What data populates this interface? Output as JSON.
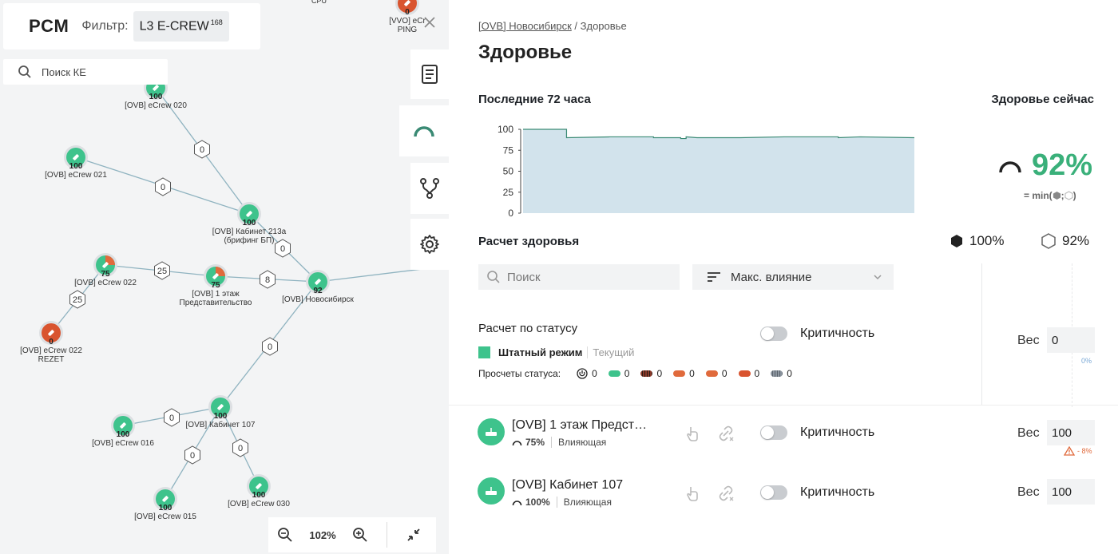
{
  "app": {
    "logo": "PCM",
    "filter_label": "Фильтр:",
    "filter_value": "L3 E-CREW",
    "filter_count": "168",
    "search_placeholder": "Поиск КЕ",
    "zoom": "102%"
  },
  "graph": {
    "nodes": [
      {
        "id": "n020",
        "score": "100",
        "label": [
          "[OVB] eCrew 020"
        ],
        "status": "green"
      },
      {
        "id": "n021",
        "score": "100",
        "label": [
          "[OVB] eCrew 021"
        ],
        "status": "green"
      },
      {
        "id": "n213",
        "score": "100",
        "label": [
          "[OVB] Кабинет 213a",
          "(брифинг БП)"
        ],
        "status": "green"
      },
      {
        "id": "n022",
        "score": "75",
        "label": [
          "[OVB] eCrew 022"
        ],
        "status": "partial"
      },
      {
        "id": "n1et",
        "score": "75",
        "label": [
          "[OVB] 1 этаж",
          "Представительство"
        ],
        "status": "partial"
      },
      {
        "id": "nnsk",
        "score": "92",
        "label": [
          "[OVB] Новосибирск"
        ],
        "status": "green"
      },
      {
        "id": "nrez",
        "score": "0",
        "label": [
          "[OVB] eCrew 022",
          "REZET"
        ],
        "status": "red"
      },
      {
        "id": "n107",
        "score": "100",
        "label": [
          "[OVB] Кабинет 107"
        ],
        "status": "green"
      },
      {
        "id": "n016",
        "score": "100",
        "label": [
          "[OVB] eCrew 016"
        ],
        "status": "green"
      },
      {
        "id": "n015",
        "score": "100",
        "label": [
          "[OVB] eCrew 015"
        ],
        "status": "green"
      },
      {
        "id": "n030",
        "score": "100",
        "label": [
          "[OVB] eCrew 030"
        ],
        "status": "green"
      },
      {
        "id": "nvvo",
        "score": "0",
        "label": [
          "[VVO] eCr",
          "PING"
        ],
        "status": "red"
      }
    ],
    "edges": [
      {
        "from": "n020",
        "to": "n213",
        "weight": "0"
      },
      {
        "from": "n021",
        "to": "n213",
        "weight": "0"
      },
      {
        "from": "n213",
        "to": "nnsk",
        "weight": "0"
      },
      {
        "from": "n022",
        "to": "n1et",
        "weight": "25"
      },
      {
        "from": "n1et",
        "to": "nnsk",
        "weight": "8"
      },
      {
        "from": "nrez",
        "to": "n022",
        "weight": "25"
      },
      {
        "from": "n107",
        "to": "nnsk",
        "weight": "0"
      },
      {
        "from": "n016",
        "to": "n107",
        "weight": "0"
      },
      {
        "from": "n015",
        "to": "n107",
        "weight": "0"
      },
      {
        "from": "n030",
        "to": "n107",
        "weight": "0"
      }
    ],
    "cut_label": "CPU"
  },
  "panel": {
    "breadcrumb_link": "[OVB] Новосибирск",
    "breadcrumb_sep": " / ",
    "breadcrumb_current": "Здоровье",
    "title": "Здоровье",
    "last72": "Последние 72 часа",
    "health_now": "Здоровье сейчас",
    "health_value": "92%",
    "min_formula": "= min(",
    "min_sep": ";",
    "min_close": ")",
    "calc_title": "Расчет здоровья",
    "hex_filled_value": "100%",
    "hex_empty_value": "92%",
    "search_placeholder": "Поиск",
    "sort_label": "Макс. влияние",
    "status_calc": "Расчет по статусу",
    "criticality": "Критичность",
    "weight_label": "Вес",
    "status_weight": "0",
    "status_weight_pct": "0%",
    "mode_name": "Штатный режим",
    "mode_current": "Текущий",
    "recalcs_label": "Просчеты статуса:",
    "recalcs": [
      {
        "icon": "power-icon",
        "value": "0"
      },
      {
        "color": "#3ec38c",
        "value": "0"
      },
      {
        "color": "#8a3a2a",
        "value": "0"
      },
      {
        "color": "#e06a3c",
        "value": "0"
      },
      {
        "color": "#e06a3c",
        "value": "0"
      },
      {
        "color": "#d9542f",
        "value": "0"
      },
      {
        "color": "#8d96a0",
        "value": "0"
      }
    ],
    "items": [
      {
        "name": "[OVB] 1 этаж Предст…",
        "score": "75%",
        "role": "Влияющая",
        "weight": "100",
        "warning": "- 8%"
      },
      {
        "name": "[OVB] Кабинет 107",
        "score": "100%",
        "role": "Влияющая",
        "weight": "100",
        "warning": ""
      }
    ]
  },
  "chart_data": {
    "type": "area",
    "title": "Последние 72 часа",
    "xlabel": "",
    "ylabel": "",
    "ylim": [
      0,
      100
    ],
    "yticks": [
      "100",
      "75",
      "50",
      "25",
      "0"
    ],
    "x": [
      0,
      8,
      8,
      16,
      24,
      24,
      29,
      29,
      30,
      30,
      32,
      40,
      48,
      58,
      58,
      62,
      72
    ],
    "values": [
      100,
      100,
      90,
      91,
      91,
      90,
      90,
      89,
      89,
      91,
      90,
      90,
      91,
      91,
      90,
      91,
      90
    ],
    "grid": false,
    "legend": "none",
    "fill_color": "#d2e3ec",
    "line_color": "#3a8a74"
  },
  "colors": {
    "green": "#3ec38c",
    "orange": "#e06a3c",
    "red": "#d9542f",
    "accent_text": "#3ab07a"
  }
}
